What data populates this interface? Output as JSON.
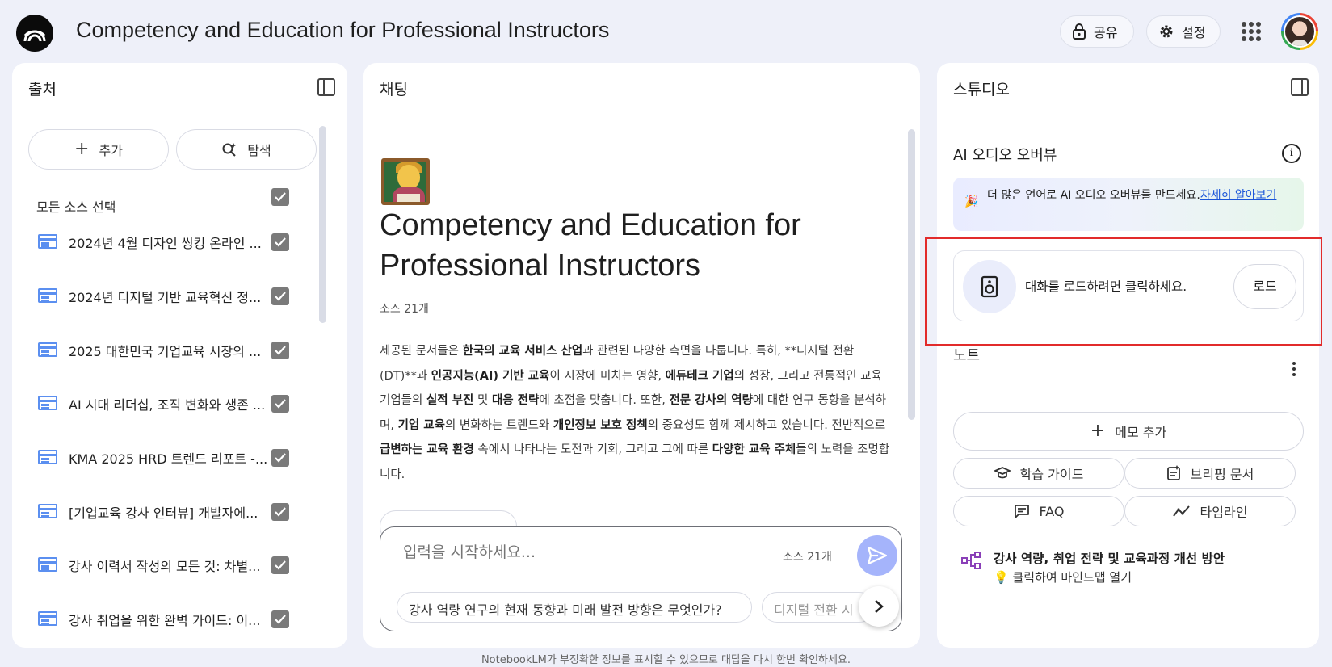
{
  "header": {
    "notebook_title": "Competency and Education for Professional Instructors",
    "share_label": "공유",
    "settings_label": "설정"
  },
  "sources": {
    "title": "출처",
    "add_label": "추가",
    "explore_label": "탐색",
    "select_all_label": "모든 소스 선택",
    "items": [
      {
        "label": "2024년 4월 디자인 씽킹 온라인 ..."
      },
      {
        "label": "2024년 디지털 기반 교육혁신 정..."
      },
      {
        "label": "2025 대한민국 기업교육 시장의 ..."
      },
      {
        "label": "AI 시대 리더십, 조직 변화와 생존 ..."
      },
      {
        "label": "KMA 2025 HRD 트렌드 리포트 -..."
      },
      {
        "label": "[기업교육 강사 인터뷰] 개발자에..."
      },
      {
        "label": "강사 이력서 작성의 모든 것: 차별..."
      },
      {
        "label": "강사 취업을 위한 완벽 가이드: 이..."
      }
    ]
  },
  "chat": {
    "title": "채팅",
    "heading": "Competency and Education for Professional Instructors",
    "source_count": "소스 21개",
    "summary": [
      {
        "t": "제공된 문서들은 ",
        "b": false
      },
      {
        "t": "한국의 교육 서비스 산업",
        "b": true
      },
      {
        "t": "과 관련된 다양한 측면을 다룹니다. 특히, **디지털 전환(DT)**과 ",
        "b": false
      },
      {
        "t": "인공지능(AI) 기반 교육",
        "b": true
      },
      {
        "t": "이 시장에 미치는 영향, ",
        "b": false
      },
      {
        "t": "에듀테크 기업",
        "b": true
      },
      {
        "t": "의 성장, 그리고 전통적인 교육 기업들의 ",
        "b": false
      },
      {
        "t": "실적 부진",
        "b": true
      },
      {
        "t": " 및 ",
        "b": false
      },
      {
        "t": "대응 전략",
        "b": true
      },
      {
        "t": "에 초점을 맞춥니다. 또한, ",
        "b": false
      },
      {
        "t": "전문 강사의 역량",
        "b": true
      },
      {
        "t": "에 대한 연구 동향을 분석하며, ",
        "b": false
      },
      {
        "t": "기업 교육",
        "b": true
      },
      {
        "t": "의 변화하는 트렌드와 ",
        "b": false
      },
      {
        "t": "개인정보 보호 정책",
        "b": true
      },
      {
        "t": "의 중요성도 함께 제시하고 있습니다. 전반적으로 ",
        "b": false
      },
      {
        "t": "급변하는 교육 환경",
        "b": true
      },
      {
        "t": " 속에서 나타나는 도전과 기회, 그리고 그에 따른 ",
        "b": false
      },
      {
        "t": "다양한 교육 주체",
        "b": true
      },
      {
        "t": "들의 노력을 조명합니다.",
        "b": false
      }
    ],
    "input_placeholder": "입력을 시작하세요...",
    "input_source_count": "소스 21개",
    "suggestions": [
      "강사 역량 연구의 현재 동향과 미래 발전 방향은 무엇인가?",
      "디지털 전환 시"
    ]
  },
  "studio": {
    "title": "스튜디오",
    "audio_overview_title": "AI 오디오 오버뷰",
    "banner_text": "더 많은 언어로 AI 오디오 오버뷰를 만드세요.",
    "banner_link": "자세히 알아보기",
    "load_text": "대화를 로드하려면 클릭하세요.",
    "load_button": "로드",
    "notes_title": "노트",
    "add_memo": "메모 추가",
    "tools": [
      "학습 가이드",
      "브리핑 문서",
      "FAQ",
      "타임라인"
    ],
    "mindmap_title": "강사 역량, 취업 전략 및 교육과정 개선 방안",
    "mindmap_sub": "클릭하여 마인드맵 열기"
  },
  "footer": {
    "disclaimer": "NotebookLM가 부정확한 정보를 표시할 수 있으므로 대답을 다시 한번 확인하세요."
  },
  "colors": {
    "background": "#eef0f9",
    "accent_blue": "#5b8ff0",
    "send_button": "#a5b4fb",
    "highlight_red": "#e22b2b"
  }
}
